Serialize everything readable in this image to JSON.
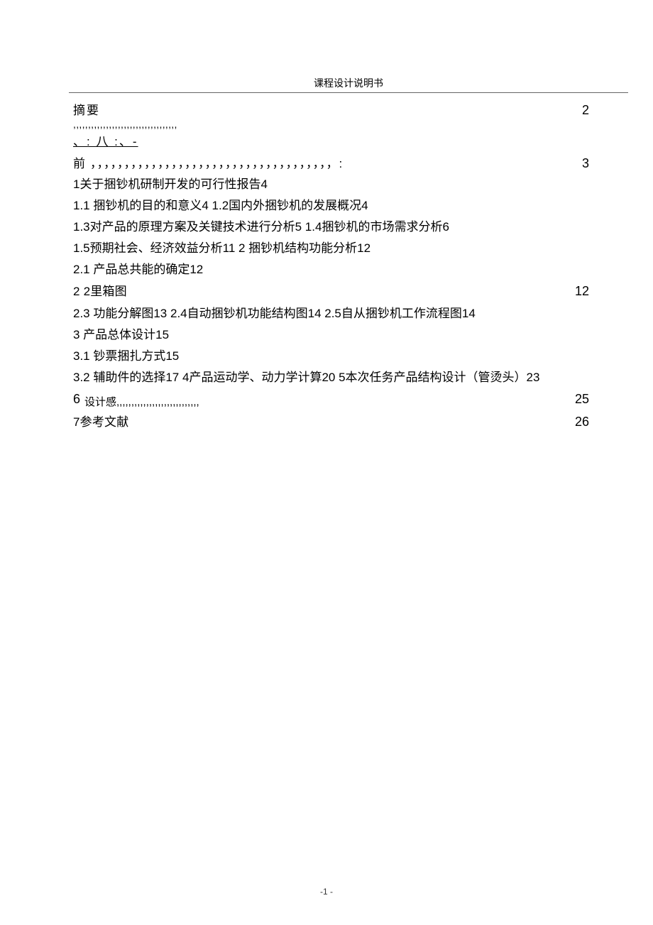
{
  "header": {
    "title": "课程设计说明书"
  },
  "toc": {
    "abstract": {
      "label": "摘要",
      "quotes": ",,,,,,,,,,,,,,,,,,,,,,,,,,,,,,,,,,,",
      "page": "2"
    },
    "underline_text": "、: 八 :、-",
    "preface": {
      "label": "前",
      "commas": "，，，，，，，，，，，，，，，，，，，，，，，，，，，，，，，，，，，，:",
      "page": "3"
    },
    "r1": "1关于捆钞机研制开发的可行性报告4",
    "r2": "1.1 捆钞机的目的和意义4 1.2国内外捆钞机的发展概况4",
    "r3": "1.3对产品的原理方案及关键技术进行分析5 1.4捆钞机的市场需求分析6",
    "r4": "1.5预期社会、经济效益分析11 2 捆钞机结构功能分析12",
    "r5": "2.1 产品总共能的确定12",
    "r6": {
      "label": "2 2里箱图",
      "page": "12"
    },
    "r7": "2.3 功能分解图13 2.4自动捆钞机功能结构图14 2.5自从捆钞机工作流程图14",
    "r8": "3 产品总体设计15",
    "r9": "3.1 钞票捆扎方式15",
    "r10": "3.2 辅助件的选择17 4产品运动学、动力学计算20 5本次任务产品结构设计（管烫头）23",
    "r11": {
      "num": "6",
      "label": "设计感,,,,,,,,,,,,,,,,,,,,,,,,,,,,",
      "page": "25"
    },
    "r12": {
      "label": "7参考文献",
      "page": "26"
    }
  },
  "footer": {
    "page_num": "-1 -"
  }
}
